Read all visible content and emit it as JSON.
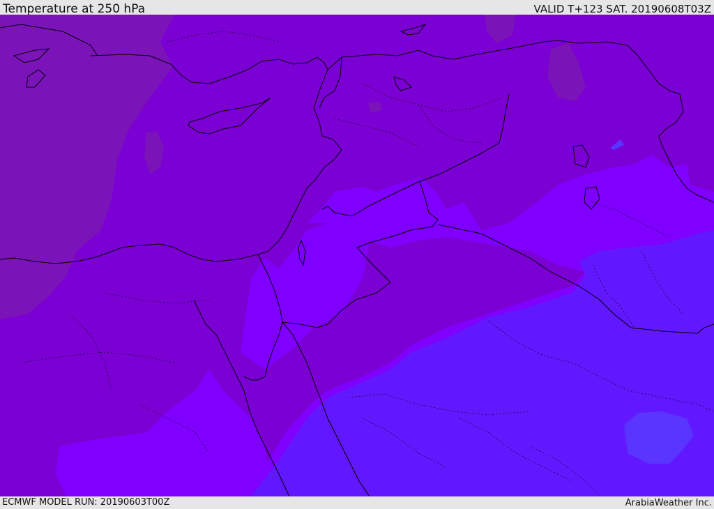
{
  "header": {
    "title": "Temperature at 250 hPa",
    "valid": "VALID T+123 SAT. 20190608T03Z"
  },
  "footer": {
    "model_run": "ECMWF MODEL RUN: 20190603T00Z",
    "credit": "ArabiaWeather Inc."
  },
  "colors": {
    "coldest": "#7a14b8",
    "colder": "#7b00d4",
    "mid": "#8000ff",
    "warm": "#6218ff",
    "warmer": "#5a34ff",
    "border": "#000000"
  }
}
